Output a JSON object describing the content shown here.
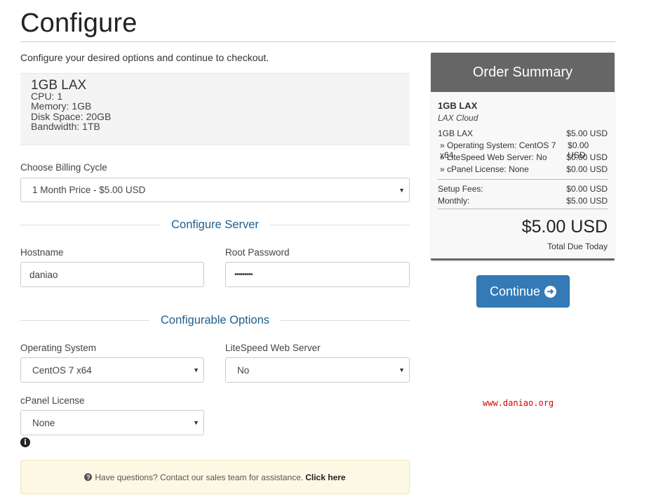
{
  "page": {
    "title": "Configure",
    "intro": "Configure your desired options and continue to checkout."
  },
  "product": {
    "name": "1GB LAX",
    "specs": [
      "CPU: 1",
      "Memory: 1GB",
      "Disk Space: 20GB",
      "Bandwidth: 1TB"
    ]
  },
  "billing": {
    "label": "Choose Billing Cycle",
    "selected": "1 Month Price - $5.00 USD"
  },
  "configure_server": {
    "heading": "Configure Server",
    "hostname_label": "Hostname",
    "hostname_value": "daniao",
    "password_label": "Root Password",
    "password_value": "•••••••••"
  },
  "configurable_options": {
    "heading": "Configurable Options",
    "os_label": "Operating System",
    "os_value": "CentOS 7 x64",
    "litespeed_label": "LiteSpeed Web Server",
    "litespeed_value": "No",
    "cpanel_label": "cPanel License",
    "cpanel_value": "None"
  },
  "help": {
    "text": "Have questions? Contact our sales team for assistance.",
    "link": "Click here"
  },
  "summary": {
    "heading": "Order Summary",
    "product": "1GB LAX",
    "group": "LAX Cloud",
    "lines": [
      {
        "label": "1GB LAX",
        "value": "$5.00 USD"
      },
      {
        "label": "» Operating System: CentOS 7 x64",
        "value": "$0.00 USD"
      },
      {
        "label": "» LiteSpeed Web Server: No",
        "value": "$0.00 USD"
      },
      {
        "label": "» cPanel License: None",
        "value": "$0.00 USD"
      }
    ],
    "setup_label": "Setup Fees:",
    "setup_value": "$0.00 USD",
    "monthly_label": "Monthly:",
    "monthly_value": "$5.00 USD",
    "total": "$5.00 USD",
    "total_label": "Total Due Today"
  },
  "continue_label": "Continue",
  "watermark": "www.daniao.org",
  "colors": {
    "accent": "#337ab7",
    "section_heading": "#1d5f8f",
    "summary_header": "#666666",
    "help_bg": "#fcf8e3"
  },
  "icons": [
    "chevron-down-icon",
    "info-icon",
    "question-circle-icon",
    "arrow-circle-right-icon"
  ]
}
